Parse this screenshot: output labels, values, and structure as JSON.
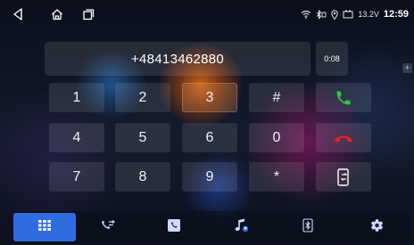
{
  "status_bar": {
    "nav_icons": [
      "back-icon",
      "home-icon",
      "recent-apps-icon"
    ],
    "status_icons": [
      "wifi-icon",
      "bluetooth-icon",
      "location-icon",
      "battery-icon"
    ],
    "voltage": "13.2V",
    "time": "12:59"
  },
  "dialer": {
    "number": "+48413462880",
    "call_duration": "0:08",
    "side_plus": "+",
    "keys": [
      "1",
      "2",
      "3",
      "#",
      "4",
      "5",
      "6",
      "0",
      "7",
      "8",
      "9",
      "*"
    ],
    "action_icons": [
      "call-icon",
      "hang-up-icon",
      "transfer-to-phone-icon"
    ],
    "colors": {
      "call": "#2ecc40",
      "hang_up": "#e8231f",
      "accent": "#2f6ce0"
    }
  },
  "bottom_tabs": {
    "items": [
      "dialpad-icon",
      "call-log-icon",
      "contacts-icon",
      "bluetooth-music-icon",
      "bluetooth-icon",
      "settings-icon"
    ],
    "active": "dialpad-icon"
  }
}
